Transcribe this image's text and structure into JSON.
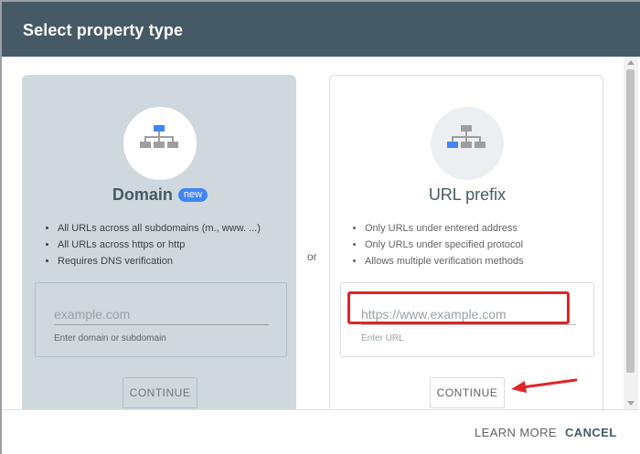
{
  "dialog": {
    "title": "Select property type"
  },
  "or_label": "or",
  "domain_card": {
    "icon": "sitemap-top-highlight-icon",
    "title": "Domain",
    "badge": "new",
    "bullets": [
      "All URLs across all subdomains (m., www. ...)",
      "All URLs across https or http",
      "Requires DNS verification"
    ],
    "input_placeholder": "example.com",
    "input_value": "",
    "input_helper": "Enter domain or subdomain",
    "continue_label": "CONTINUE"
  },
  "url_card": {
    "icon": "sitemap-left-child-highlight-icon",
    "title": "URL prefix",
    "bullets": [
      "Only URLs under entered address",
      "Only URLs under specified protocol",
      "Allows multiple verification methods"
    ],
    "input_placeholder": "https://www.example.com",
    "input_value": "",
    "input_helper": "Enter URL",
    "continue_label": "CONTINUE"
  },
  "footer": {
    "learn_more_label": "LEARN MORE",
    "cancel_label": "CANCEL"
  },
  "colors": {
    "header_bg": "#455a64",
    "domain_card_bg": "#cfd8dc",
    "accent_blue": "#4285f4",
    "annotation_red": "#e02429"
  }
}
